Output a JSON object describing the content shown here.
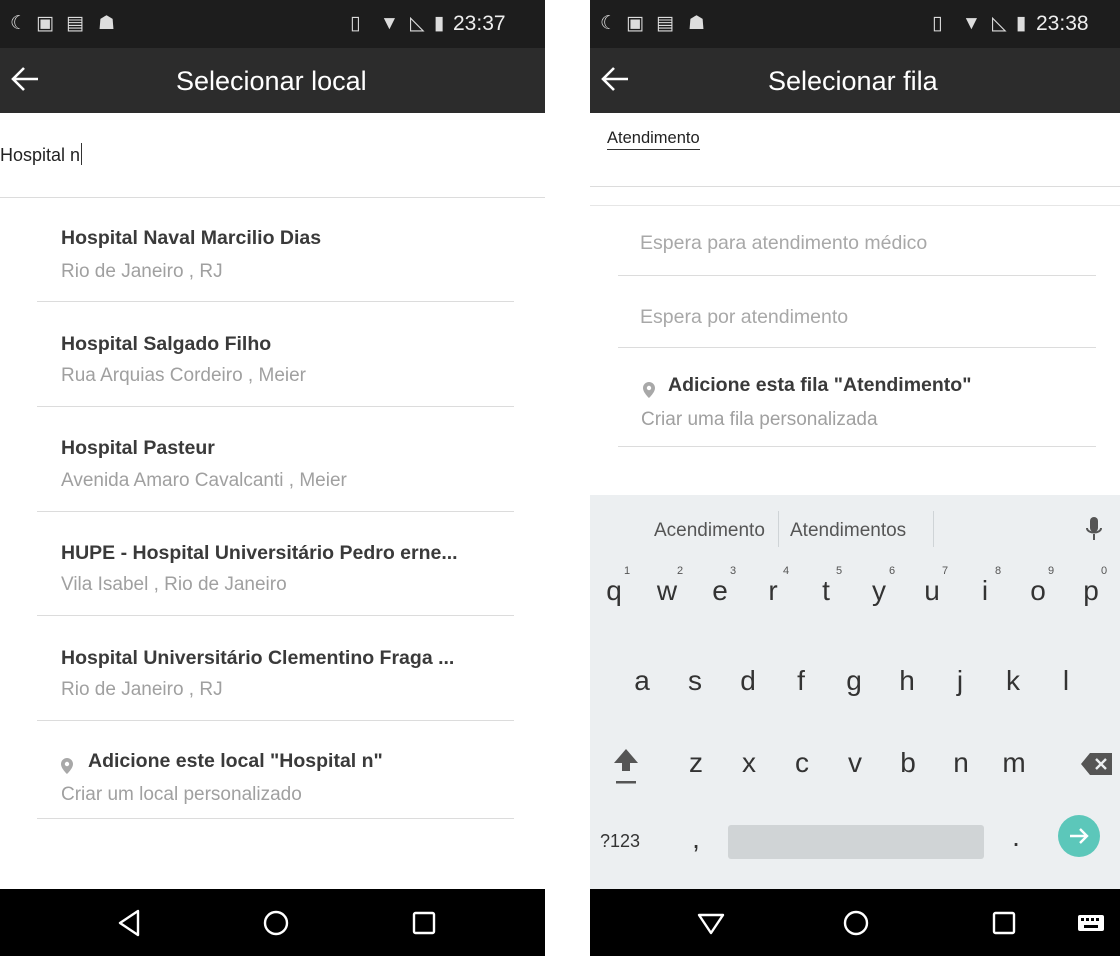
{
  "left": {
    "status": {
      "time": "23:37"
    },
    "title": "Selecionar local",
    "search_value": "Hospital n",
    "items": [
      {
        "title": "Hospital Naval Marcilio Dias",
        "subtitle": "Rio de Janeiro , RJ"
      },
      {
        "title": "Hospital Salgado Filho",
        "subtitle": "Rua Arquias Cordeiro , Meier"
      },
      {
        "title": "Hospital Pasteur",
        "subtitle": "Avenida Amaro Cavalcanti , Meier"
      },
      {
        "title": "HUPE - Hospital Universitário Pedro erne...",
        "subtitle": "Vila Isabel , Rio de Janeiro"
      },
      {
        "title": "Hospital Universitário Clementino Fraga ...",
        "subtitle": "Rio de Janeiro , RJ"
      }
    ],
    "add": {
      "title": "Adicione este local \"Hospital n\"",
      "subtitle": "Criar um local personalizado",
      "icon": "location-pin-icon"
    }
  },
  "right": {
    "status": {
      "time": "23:38"
    },
    "title": "Selecionar fila",
    "field_value": "Atendimento",
    "suggestions": [
      "Espera para atendimento médico",
      "Espera por atendimento"
    ],
    "add": {
      "title": "Adicione esta fila \"Atendimento\"",
      "subtitle": "Criar uma fila personalizada",
      "icon": "location-pin-icon"
    },
    "keyboard": {
      "suggestions": [
        "Acendimento",
        "Atendimentos"
      ],
      "row1": [
        "q",
        "w",
        "e",
        "r",
        "t",
        "y",
        "u",
        "i",
        "o",
        "p"
      ],
      "row1_hints": [
        "1",
        "2",
        "3",
        "4",
        "5",
        "6",
        "7",
        "8",
        "9",
        "0"
      ],
      "row2": [
        "a",
        "s",
        "d",
        "f",
        "g",
        "h",
        "j",
        "k",
        "l"
      ],
      "row3": [
        "z",
        "x",
        "c",
        "v",
        "b",
        "n",
        "m"
      ],
      "sym_label": "?123",
      "comma": ",",
      "period": "."
    }
  },
  "colors": {
    "statusbar": "#1d1d1d",
    "appbar": "#2c2c2c",
    "accent": "#5cc7ba",
    "keyboard_bg": "#eceff1"
  }
}
